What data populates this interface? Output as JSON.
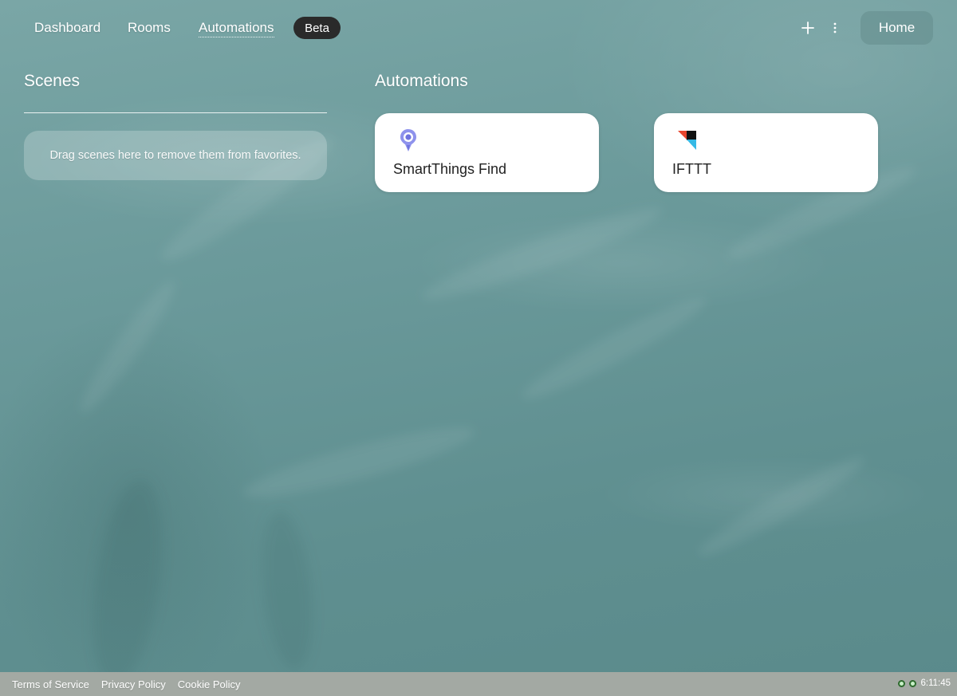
{
  "nav": {
    "links": [
      {
        "label": "Dashboard",
        "active": false
      },
      {
        "label": "Rooms",
        "active": false
      },
      {
        "label": "Automations",
        "active": true
      }
    ],
    "beta_label": "Beta",
    "add_icon": "plus-icon",
    "menu_icon": "more-vertical-icon",
    "home_label": "Home"
  },
  "scenes": {
    "title": "Scenes",
    "drop_hint": "Drag scenes here to remove them from favorites."
  },
  "automations": {
    "title": "Automations",
    "cards": [
      {
        "label": "SmartThings Find",
        "icon": "location-pin-icon",
        "icon_color": "#7b7fe6"
      },
      {
        "label": "IFTTT",
        "icon": "ifttt-logo-icon",
        "icon_colors": [
          "#e8462e",
          "#111111",
          "#35b9e5"
        ]
      }
    ]
  },
  "footer": {
    "links": [
      "Terms of Service",
      "Privacy Policy",
      "Cookie Policy"
    ],
    "time": "6:11:45"
  },
  "colors": {
    "background": "#6b9a9b",
    "beta_bg": "#2a2a2a",
    "card_bg": "#ffffff",
    "footer_bg": "#a3a9a3",
    "status_dot": "#c7f0c7"
  }
}
